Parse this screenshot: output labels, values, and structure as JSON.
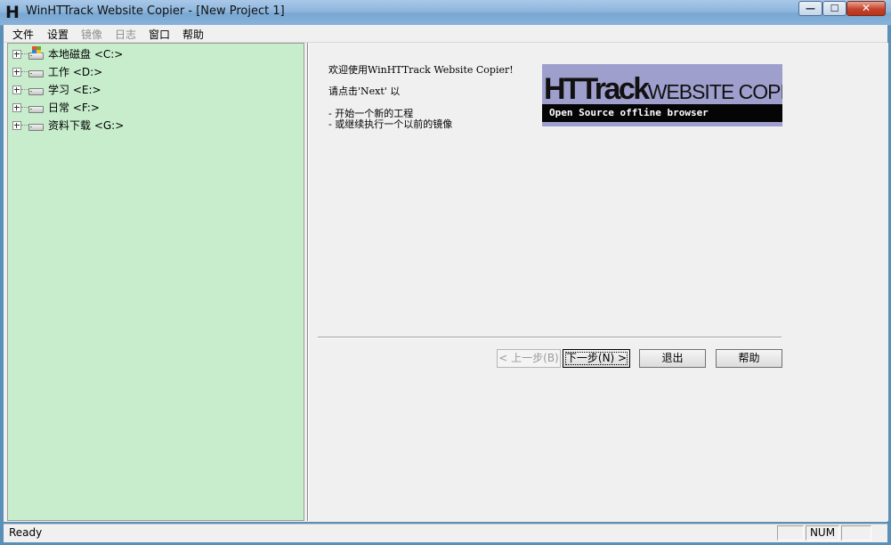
{
  "window": {
    "title": "WinHTTrack Website Copier - [New Project 1]",
    "icon_letter": "H",
    "controls": {
      "minimize": "—",
      "maximize": "☐",
      "close": "✕"
    }
  },
  "menu": {
    "items": [
      {
        "label": "文件",
        "enabled": true
      },
      {
        "label": "设置",
        "enabled": true
      },
      {
        "label": "镜像",
        "enabled": false
      },
      {
        "label": "日志",
        "enabled": false
      },
      {
        "label": "窗口",
        "enabled": true
      },
      {
        "label": "帮助",
        "enabled": true
      }
    ]
  },
  "tree": {
    "background": "#c7edcc",
    "items": [
      {
        "label": "本地磁盘 <C:>",
        "icon": "system-drive-icon"
      },
      {
        "label": "工作 <D:>",
        "icon": "drive-icon"
      },
      {
        "label": "学习 <E:>",
        "icon": "drive-icon"
      },
      {
        "label": "日常 <F:>",
        "icon": "drive-icon"
      },
      {
        "label": "资料下载 <G:>",
        "icon": "drive-icon"
      }
    ]
  },
  "wizard": {
    "line1": "欢迎使用WinHTTrack Website Copier!",
    "line2": "请点击'Next' 以",
    "line3": "- 开始一个新的工程",
    "line4": "- 或继续执行一个以前的镜像",
    "logo": {
      "title": "HTTrack",
      "title_suffix": "WEBSITE COPIER",
      "subtitle": "Open Source offline browser"
    },
    "buttons": {
      "back": "< 上一步(B)",
      "next": "下一步(N) >",
      "exit": "退出",
      "help": "帮助"
    }
  },
  "status": {
    "text": "Ready",
    "num": "NUM"
  }
}
